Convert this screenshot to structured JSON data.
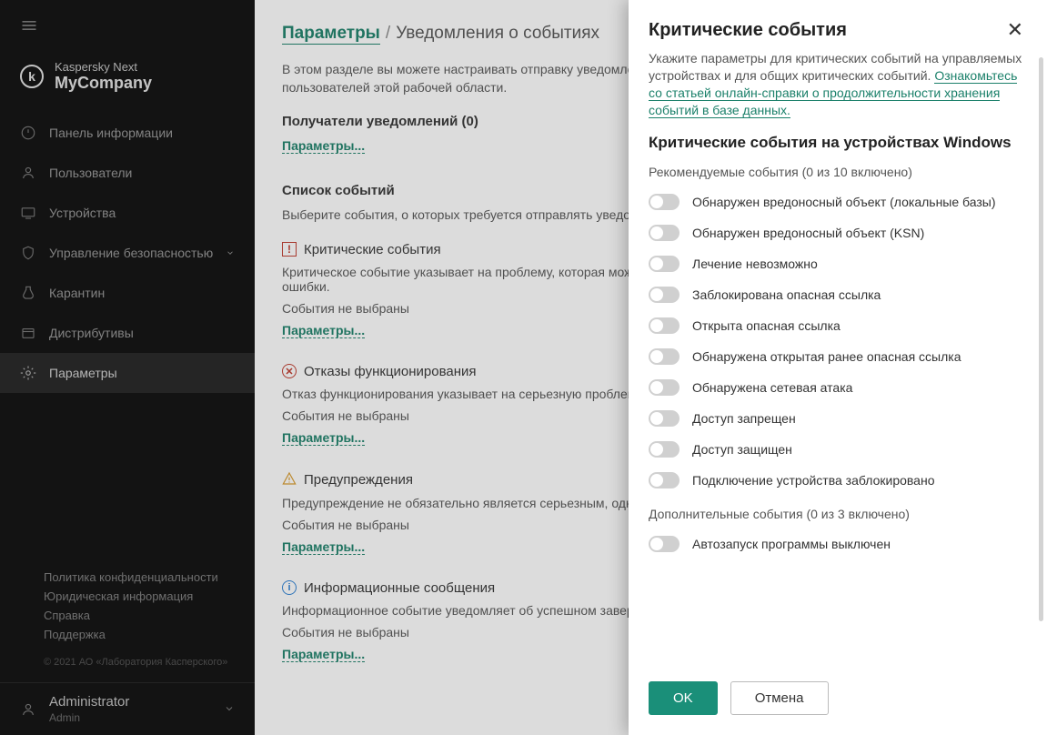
{
  "brand": {
    "line1": "Kaspersky Next",
    "line2": "MyCompany",
    "logo_letter": "k"
  },
  "nav": {
    "items": [
      {
        "label": "Панель информации",
        "icon": "dashboard-icon"
      },
      {
        "label": "Пользователи",
        "icon": "users-icon"
      },
      {
        "label": "Устройства",
        "icon": "devices-icon"
      },
      {
        "label": "Управление безопасностью",
        "icon": "security-icon",
        "has_dropdown": true
      },
      {
        "label": "Карантин",
        "icon": "quarantine-icon"
      },
      {
        "label": "Дистрибутивы",
        "icon": "packages-icon"
      },
      {
        "label": "Параметры",
        "icon": "settings-icon",
        "active": true
      }
    ]
  },
  "footer": {
    "links": [
      "Политика конфиденциальности",
      "Юридическая информация",
      "Справка",
      "Поддержка"
    ],
    "copyright": "© 2021 АО «Лаборатория Касперского»"
  },
  "user": {
    "name": "Administrator",
    "role": "Admin"
  },
  "breadcrumb": {
    "root": "Параметры",
    "current": "Уведомления о событиях"
  },
  "main": {
    "intro": "В этом разделе вы можете настраивать отправку уведомлений о событиях безопасности на адреса электронной почты пользователей этой рабочей области.",
    "recipients_title": "Получатели уведомлений (0)",
    "params_link": "Параметры...",
    "list_title": "Список событий",
    "list_sub": "Выберите события, о которых требуется отправлять уведомления.",
    "sections": {
      "critical": {
        "title": "Критические события",
        "desc": "Критическое событие указывает на проблему, которая может привести к потере данных или возникновении критической ошибки.",
        "none": "События не выбраны"
      },
      "failure": {
        "title": "Отказы функционирования",
        "desc": "Отказ функционирования указывает на серьезную проблему в работе операционной системы или программы.",
        "none": "События не выбраны"
      },
      "warning": {
        "title": "Предупреждения",
        "desc": "Предупреждение не обязательно является серьезным, однако указывает на возможную проблему.",
        "none": "События не выбраны"
      },
      "info": {
        "title": "Информационные сообщения",
        "desc": "Информационное событие уведомляет об успешном завершении операции, о правильной работе программы.",
        "none": "События не выбраны"
      }
    }
  },
  "modal": {
    "title": "Критические события",
    "intro": "Укажите параметры для критических событий на управляемых устройствах и для общих критических событий.",
    "help_link": "Ознакомьтесь со статьей онлайн-справки о продолжительности хранения событий в базе данных.",
    "subhead": "Критические события на устройствах Windows",
    "group1_label": "Рекомендуемые события (0 из 10 включено)",
    "toggles_recommended": [
      "Обнаружен вредоносный объект (локальные базы)",
      "Обнаружен вредоносный объект (KSN)",
      "Лечение невозможно",
      "Заблокирована опасная ссылка",
      "Открыта опасная ссылка",
      "Обнаружена открытая ранее опасная ссылка",
      "Обнаружена сетевая атака",
      "Доступ запрещен",
      "Доступ защищен",
      "Подключение устройства заблокировано"
    ],
    "group2_label": "Дополнительные события (0 из 3 включено)",
    "toggles_additional": [
      "Автозапуск программы выключен"
    ],
    "ok": "OK",
    "cancel": "Отмена"
  }
}
